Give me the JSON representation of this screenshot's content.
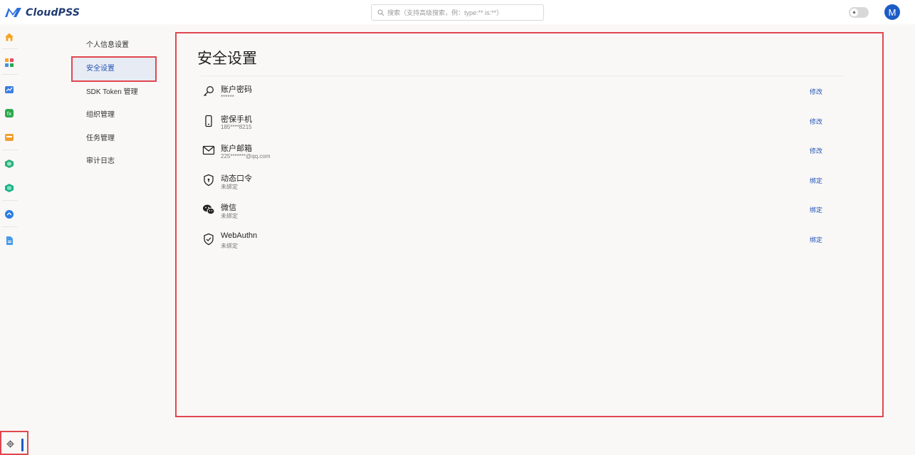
{
  "header": {
    "app_name": "CloudPSS",
    "search_placeholder": "搜索（支持高级搜索，例：type:** is:**）",
    "avatar_initial": "M",
    "theme_icon": "sun-icon"
  },
  "rail": {
    "items": [
      {
        "name": "home-icon",
        "color": "#f5a623"
      },
      {
        "name": "apps-grid-icon",
        "color": "#4a90e2"
      },
      {
        "name": "simstudio-icon",
        "color": "#3b7de0"
      },
      {
        "name": "function-icon",
        "color": "#2aa84a"
      },
      {
        "name": "applab-icon",
        "color": "#f0a030"
      },
      {
        "name": "cube-green-icon",
        "color": "#27b07a"
      },
      {
        "name": "cube-teal-icon",
        "color": "#1fb38a"
      },
      {
        "name": "model-blue-icon",
        "color": "#2a7de1"
      },
      {
        "name": "document-icon",
        "color": "#4a9ae8"
      }
    ],
    "settings_icon": "gear-icon"
  },
  "nav": {
    "items": [
      {
        "label": "个人信息设置",
        "active": false
      },
      {
        "label": "安全设置",
        "active": true
      },
      {
        "label": "SDK Token 管理",
        "active": false
      },
      {
        "label": "组织管理",
        "active": false
      },
      {
        "label": "任务管理",
        "active": false
      },
      {
        "label": "审计日志",
        "active": false
      }
    ]
  },
  "main": {
    "title": "安全设置",
    "rows": [
      {
        "icon": "key-icon",
        "title": "账户密码",
        "sub": "******",
        "action": "修改"
      },
      {
        "icon": "phone-icon",
        "title": "密保手机",
        "sub": "185****8215",
        "action": "修改"
      },
      {
        "icon": "mail-icon",
        "title": "账户邮箱",
        "sub": "225*******@qq.com",
        "action": "修改"
      },
      {
        "icon": "shield-icon",
        "title": "动态口令",
        "sub": "未绑定",
        "action": "绑定"
      },
      {
        "icon": "wechat-icon",
        "title": "微信",
        "sub": "未绑定",
        "action": "绑定"
      },
      {
        "icon": "shield-check-icon",
        "title": "WebAuthn",
        "sub": "未绑定",
        "action": "绑定"
      }
    ]
  },
  "colors": {
    "accent": "#2456b5",
    "highlight_border": "#e0474f",
    "avatar_bg": "#1d5cc7"
  }
}
